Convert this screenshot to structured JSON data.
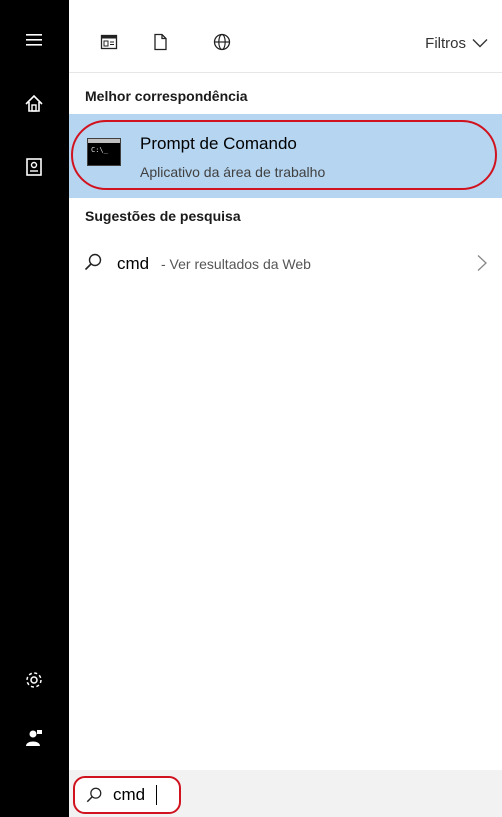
{
  "rail": {
    "icons": [
      "menu-icon",
      "home-icon",
      "notebook-icon",
      "settings-icon",
      "feedback-icon"
    ]
  },
  "toolbar": {
    "icons": [
      "documents-icon",
      "file-icon",
      "web-icon"
    ],
    "filters_label": "Filtros"
  },
  "best_match": {
    "heading": "Melhor correspondência",
    "title": "Prompt de Comando",
    "subtitle": "Aplicativo da área de trabalho",
    "tile_text": "C:\\_"
  },
  "suggestions": {
    "heading": "Sugestões de pesquisa",
    "items": [
      {
        "term": "cmd",
        "extra": " - Ver resultados da Web"
      }
    ]
  },
  "search": {
    "value": "cmd",
    "placeholder": ""
  },
  "colors": {
    "rail": "#000000",
    "selected_bg": "#b6d5f0",
    "annotation": "#d0131f",
    "searchbar_bg": "#f2f2f2"
  }
}
